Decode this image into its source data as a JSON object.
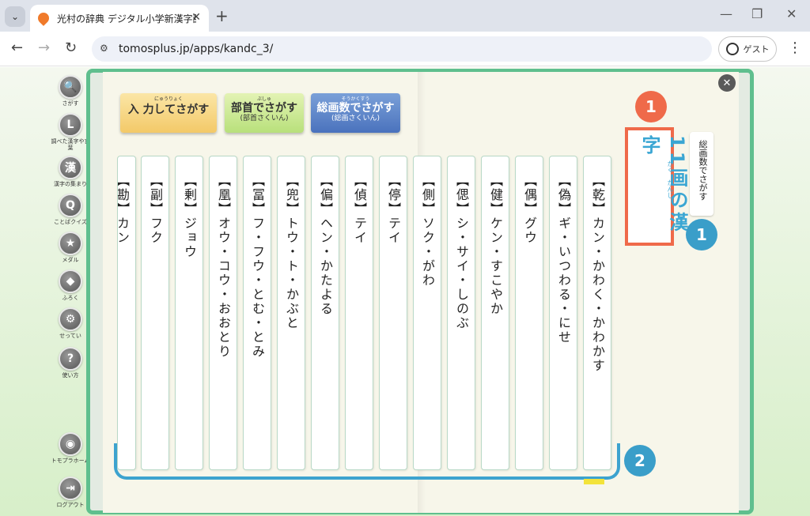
{
  "browser": {
    "tab_title": "光村の辞典 デジタル小学新漢字辞典",
    "url": "tomosplus.jp/apps/kandc_3/",
    "profile_label": "ゲスト",
    "tab_menu_icon": "chevron-down-icon",
    "new_tab": "+",
    "tab_close": "✕",
    "win_min": "—",
    "win_max": "❐",
    "win_close": "✕"
  },
  "sidebar": {
    "items": [
      {
        "icon": "search-icon",
        "glyph": "🔍",
        "label": "さがす"
      },
      {
        "icon": "history-icon",
        "glyph": "L",
        "label": "調べた漢字や言葉"
      },
      {
        "icon": "kanji-icon",
        "glyph": "漢",
        "label": "漢字の集まり"
      },
      {
        "icon": "quiz-icon",
        "glyph": "Q",
        "label": "ことばクイズ"
      },
      {
        "icon": "medal-icon",
        "glyph": "★",
        "label": "メダル"
      },
      {
        "icon": "gift-icon",
        "glyph": "◆",
        "label": "ふろく"
      },
      {
        "icon": "gear-icon",
        "glyph": "⚙",
        "label": "せってい"
      },
      {
        "icon": "help-icon",
        "glyph": "?",
        "label": "使い方"
      },
      {
        "icon": "tomopla-home-icon",
        "glyph": "◉",
        "label": "トモプラホーム"
      },
      {
        "icon": "logout-icon",
        "glyph": "⇥",
        "label": "ログアウト"
      }
    ]
  },
  "search_buttons": {
    "input": {
      "ruby": "にゅうりょく",
      "label": "入 力してさがす"
    },
    "radical": {
      "ruby": "ぶしゅ",
      "label": "部首でさがす",
      "sub": "(部首さくいん)"
    },
    "strokes": {
      "ruby": "そうかくすう",
      "label": "総画数でさがす",
      "sub": "(総画さくいん)"
    }
  },
  "page_title": {
    "text": "11画の漢字",
    "ruby": "かく　かんじ"
  },
  "header_label": "総画数でさがす",
  "badges": {
    "orange": "1",
    "blue1": "1",
    "blue2": "2"
  },
  "cards": [
    {
      "kanji": "乾",
      "reading": "カン・かわく・かわかす"
    },
    {
      "kanji": "偽",
      "reading": "ギ・いつわる・にせ"
    },
    {
      "kanji": "偶",
      "reading": "グウ"
    },
    {
      "kanji": "健",
      "reading": "ケン・すこやか"
    },
    {
      "kanji": "偲",
      "reading": "シ・サイ・しのぶ"
    },
    {
      "kanji": "側",
      "reading": "ソク・がわ"
    },
    {
      "kanji": "停",
      "reading": "テイ"
    },
    {
      "kanji": "偵",
      "reading": "テイ"
    },
    {
      "kanji": "偏",
      "reading": "ヘン・かたよる"
    },
    {
      "kanji": "兜",
      "reading": "トウ・ト・かぶと"
    },
    {
      "kanji": "冨",
      "reading": "フ・フウ・とむ・とみ"
    },
    {
      "kanji": "凰",
      "reading": "オウ・コウ・おおとり"
    },
    {
      "kanji": "剰",
      "reading": "ジョウ"
    },
    {
      "kanji": "副",
      "reading": "フク"
    },
    {
      "kanji": "勘",
      "reading": "カン"
    }
  ]
}
